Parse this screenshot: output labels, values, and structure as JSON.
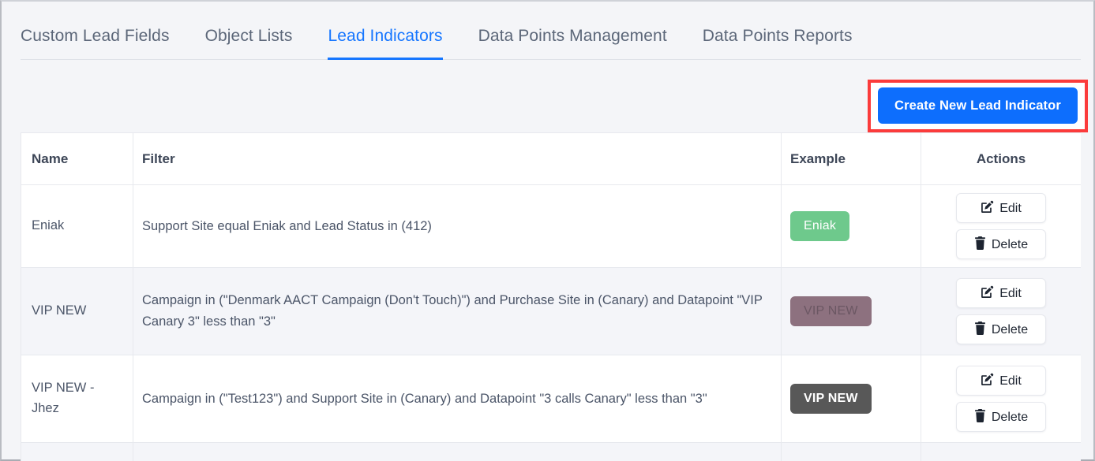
{
  "tabs": [
    {
      "label": "Custom Lead Fields",
      "active": false
    },
    {
      "label": "Object Lists",
      "active": false
    },
    {
      "label": "Lead Indicators",
      "active": true
    },
    {
      "label": "Data Points Management",
      "active": false
    },
    {
      "label": "Data Points Reports",
      "active": false
    }
  ],
  "toolbar": {
    "create_label": "Create New Lead Indicator",
    "accent_color": "#0d6efd",
    "highlight_color": "#fb3b3b"
  },
  "table": {
    "headers": {
      "name": "Name",
      "filter": "Filter",
      "example": "Example",
      "actions": "Actions"
    },
    "rows": [
      {
        "name": "Eniak",
        "filter": "Support Site equal Eniak and Lead Status in (412)",
        "example_label": "Eniak",
        "example_color": "#6ec98c",
        "edit_label": "Edit",
        "delete_label": "Delete"
      },
      {
        "name": "VIP NEW",
        "filter": "Campaign in (\"Denmark AACT Campaign (Don't Touch)\") and Purchase Site in (Canary) and Datapoint \"VIP Canary 3\" less than \"3\"",
        "example_label": "VIP NEW",
        "example_color": "#8d717f",
        "edit_label": "Edit",
        "delete_label": "Delete"
      },
      {
        "name": "VIP NEW - Jhez",
        "filter": "Campaign in (\"Test123\") and Support Site in (Canary) and Datapoint \"3 calls Canary\" less than \"3\"",
        "example_label": "VIP NEW",
        "example_color": "#585858",
        "edit_label": "Edit",
        "delete_label": "Delete"
      }
    ]
  }
}
